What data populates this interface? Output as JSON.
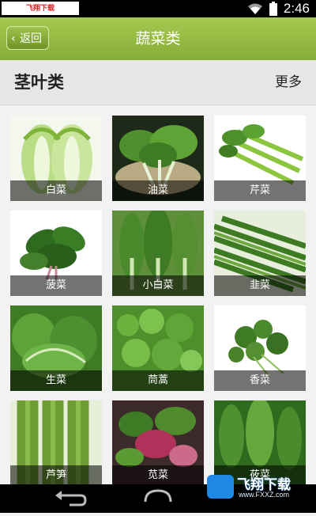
{
  "status_bar": {
    "source_label": "飞翔下载 www.FXXZ.com",
    "time": "2:46",
    "icons": [
      "wifi-icon",
      "battery-icon"
    ]
  },
  "nav": {
    "back_label": "返回",
    "title": "蔬菜类"
  },
  "section": {
    "title": "茎叶类",
    "more_label": "更多"
  },
  "tiles": [
    {
      "label": "白菜"
    },
    {
      "label": "油菜"
    },
    {
      "label": "芹菜"
    },
    {
      "label": "菠菜"
    },
    {
      "label": "小白菜"
    },
    {
      "label": "韭菜"
    },
    {
      "label": "生菜"
    },
    {
      "label": "茼蒿"
    },
    {
      "label": "香菜"
    },
    {
      "label": "芦笋"
    },
    {
      "label": "苋菜"
    },
    {
      "label": "莜菜"
    }
  ],
  "watermark": {
    "text": "飞翔下载",
    "url": "www.FXXZ.com"
  },
  "colors": {
    "nav_green": "#96ba43",
    "status_bar": "#000000",
    "section_bg": "#e6e6e6"
  }
}
